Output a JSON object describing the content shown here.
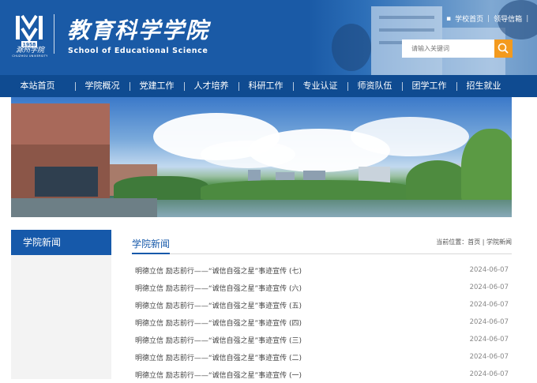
{
  "header": {
    "emblem_text": "1958",
    "school_name_cn": "滁州学院",
    "school_name_en": "CHUZHOU UNIVERSITY",
    "college_name_cn": "教育科学学院",
    "college_name_en": "School of Educational Science",
    "top_links": [
      "学校首页",
      "领导信箱"
    ],
    "search_placeholder": "请输入关键词",
    "colors": {
      "header_bg": "#1a5aa6",
      "nav_bg": "#0f4b91",
      "search_button": "#f39a1e"
    }
  },
  "nav": {
    "items": [
      "本站首页",
      "学院概况",
      "党建工作",
      "人才培养",
      "科研工作",
      "专业认证",
      "师资队伍",
      "团学工作",
      "招生就业"
    ]
  },
  "sidebar": {
    "title": "学院新闻"
  },
  "main": {
    "section_title": "学院新闻",
    "breadcrumb": {
      "prefix": "当前位置：",
      "home": "首页",
      "separator": "|",
      "current": "学院新闻"
    },
    "news": [
      {
        "title": "明德立信 励志前行——“诚信自强之星”事迹宣传 (七)",
        "date": "2024-06-07"
      },
      {
        "title": "明德立信 励志前行——“诚信自强之星”事迹宣传 (六)",
        "date": "2024-06-07"
      },
      {
        "title": "明德立信 励志前行——“诚信自强之星”事迹宣传 (五)",
        "date": "2024-06-07"
      },
      {
        "title": "明德立信 励志前行——“诚信自强之星”事迹宣传 (四)",
        "date": "2024-06-07"
      },
      {
        "title": "明德立信 励志前行——“诚信自强之星”事迹宣传 (三)",
        "date": "2024-06-07"
      },
      {
        "title": "明德立信 励志前行——“诚信自强之星”事迹宣传 (二)",
        "date": "2024-06-07"
      },
      {
        "title": "明德立信 励志前行——“诚信自强之星”事迹宣传 (一)",
        "date": "2024-06-07"
      }
    ]
  }
}
